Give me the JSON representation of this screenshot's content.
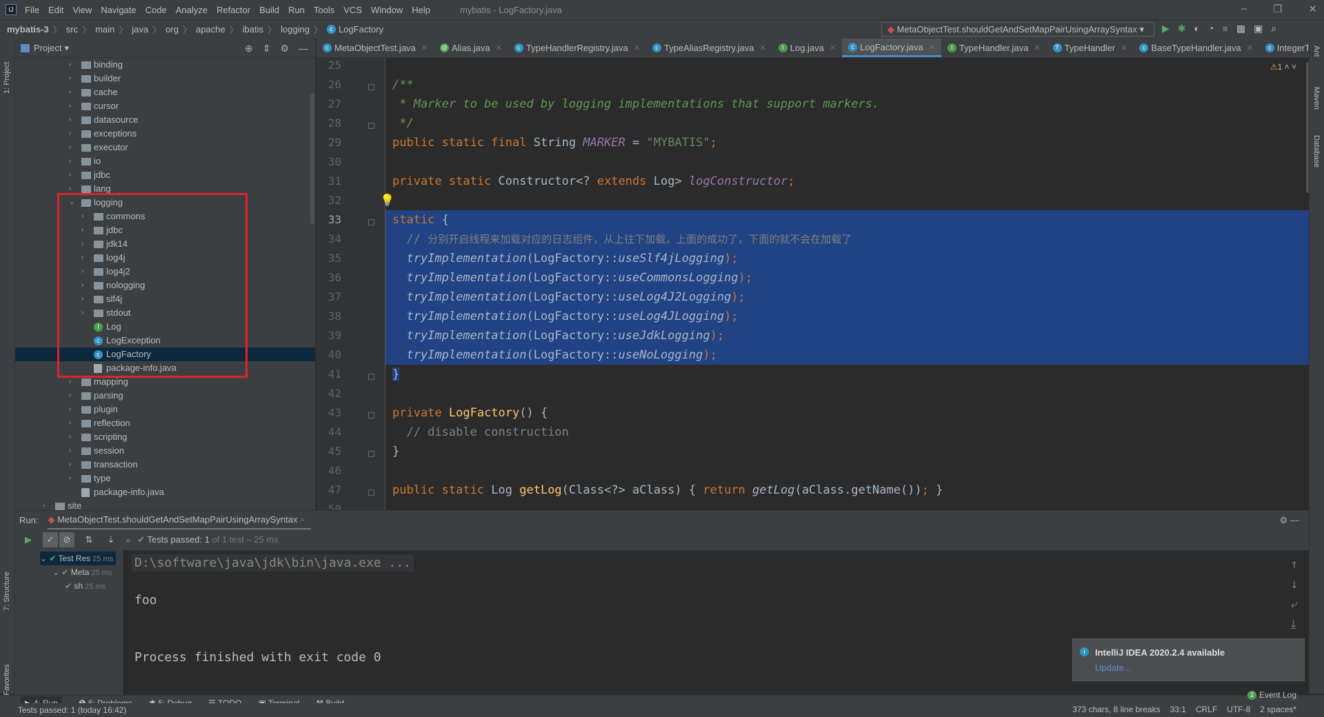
{
  "menu": {
    "items": [
      "File",
      "Edit",
      "View",
      "Navigate",
      "Code",
      "Analyze",
      "Refactor",
      "Build",
      "Run",
      "Tools",
      "VCS",
      "Window",
      "Help"
    ],
    "title": "mybatis - LogFactory.java"
  },
  "breadcrumb": [
    "mybatis-3",
    "src",
    "main",
    "java",
    "org",
    "apache",
    "ibatis",
    "logging",
    "LogFactory"
  ],
  "run_config": "MetaObjectTest.shouldGetAndSetMapPairUsingArraySyntax",
  "left_strip": {
    "project": "1: Project",
    "structure": "7: Structure",
    "favorites": "2: Favorites"
  },
  "right_strip": {
    "ant": "Ant",
    "maven": "Maven",
    "database": "Database"
  },
  "project": {
    "title": "Project",
    "tree": [
      {
        "label": "binding",
        "level": 1,
        "kind": "folder",
        "expanded": false
      },
      {
        "label": "builder",
        "level": 1,
        "kind": "folder",
        "expanded": false
      },
      {
        "label": "cache",
        "level": 1,
        "kind": "folder",
        "expanded": false
      },
      {
        "label": "cursor",
        "level": 1,
        "kind": "folder",
        "expanded": false
      },
      {
        "label": "datasource",
        "level": 1,
        "kind": "folder",
        "expanded": false
      },
      {
        "label": "exceptions",
        "level": 1,
        "kind": "folder",
        "expanded": false
      },
      {
        "label": "executor",
        "level": 1,
        "kind": "folder",
        "expanded": false
      },
      {
        "label": "io",
        "level": 1,
        "kind": "folder",
        "expanded": false
      },
      {
        "label": "jdbc",
        "level": 1,
        "kind": "folder",
        "expanded": false
      },
      {
        "label": "lang",
        "level": 1,
        "kind": "folder",
        "expanded": false
      },
      {
        "label": "logging",
        "level": 1,
        "kind": "folder",
        "expanded": true
      },
      {
        "label": "commons",
        "level": 2,
        "kind": "folder",
        "expanded": false
      },
      {
        "label": "jdbc",
        "level": 2,
        "kind": "folder",
        "expanded": false
      },
      {
        "label": "jdk14",
        "level": 2,
        "kind": "folder",
        "expanded": false
      },
      {
        "label": "log4j",
        "level": 2,
        "kind": "folder",
        "expanded": false
      },
      {
        "label": "log4j2",
        "level": 2,
        "kind": "folder",
        "expanded": false
      },
      {
        "label": "nologging",
        "level": 2,
        "kind": "folder",
        "expanded": false
      },
      {
        "label": "slf4j",
        "level": 2,
        "kind": "folder",
        "expanded": false
      },
      {
        "label": "stdout",
        "level": 2,
        "kind": "folder",
        "expanded": false
      },
      {
        "label": "Log",
        "level": 2,
        "kind": "interface"
      },
      {
        "label": "LogException",
        "level": 2,
        "kind": "class"
      },
      {
        "label": "LogFactory",
        "level": 2,
        "kind": "class",
        "selected": true
      },
      {
        "label": "package-info.java",
        "level": 2,
        "kind": "file"
      },
      {
        "label": "mapping",
        "level": 1,
        "kind": "folder",
        "expanded": false
      },
      {
        "label": "parsing",
        "level": 1,
        "kind": "folder",
        "expanded": false
      },
      {
        "label": "plugin",
        "level": 1,
        "kind": "folder",
        "expanded": false
      },
      {
        "label": "reflection",
        "level": 1,
        "kind": "folder",
        "expanded": false
      },
      {
        "label": "scripting",
        "level": 1,
        "kind": "folder",
        "expanded": false
      },
      {
        "label": "session",
        "level": 1,
        "kind": "folder",
        "expanded": false
      },
      {
        "label": "transaction",
        "level": 1,
        "kind": "folder",
        "expanded": false
      },
      {
        "label": "type",
        "level": 1,
        "kind": "folder",
        "expanded": false
      },
      {
        "label": "package-info.java",
        "level": 1,
        "kind": "file"
      },
      {
        "label": "site",
        "level": -1,
        "kind": "folder",
        "expanded": false
      }
    ]
  },
  "tabs": [
    {
      "label": "MetaObjectTest.java",
      "icon": "c"
    },
    {
      "label": "Alias.java",
      "icon": "@"
    },
    {
      "label": "TypeHandlerRegistry.java",
      "icon": "c"
    },
    {
      "label": "TypeAliasRegistry.java",
      "icon": "c"
    },
    {
      "label": "Log.java",
      "icon": "I"
    },
    {
      "label": "LogFactory.java",
      "icon": "c",
      "active": true
    },
    {
      "label": "TypeHandler.java",
      "icon": "I"
    },
    {
      "label": "TypeHandler",
      "icon": "T"
    },
    {
      "label": "BaseTypeHandler.java",
      "icon": "c"
    },
    {
      "label": "IntegerT",
      "icon": "c"
    }
  ],
  "editor": {
    "warnings": "1",
    "current_line": 33,
    "selection": [
      33,
      41
    ],
    "lines": [
      {
        "n": 25,
        "t": []
      },
      {
        "n": 26,
        "t": [
          [
            "/**",
            "d"
          ]
        ]
      },
      {
        "n": 27,
        "t": [
          [
            " * Marker to be used by logging implementations that support markers.",
            "d"
          ]
        ]
      },
      {
        "n": 28,
        "t": [
          [
            " */",
            "d"
          ]
        ]
      },
      {
        "n": 29,
        "t": [
          [
            "public static final ",
            "k"
          ],
          [
            "String ",
            "p"
          ],
          [
            "MARKER",
            "f"
          ],
          [
            " = ",
            "p"
          ],
          [
            "\"MYBATIS\"",
            "s"
          ],
          [
            ";",
            "k"
          ]
        ]
      },
      {
        "n": 30,
        "t": []
      },
      {
        "n": 31,
        "t": [
          [
            "private static ",
            "k"
          ],
          [
            "Constructor<? ",
            "p"
          ],
          [
            "extends ",
            "k"
          ],
          [
            "Log> ",
            "p"
          ],
          [
            "logConstructor",
            "f"
          ],
          [
            ";",
            "k"
          ]
        ]
      },
      {
        "n": 32,
        "t": []
      },
      {
        "n": 33,
        "t": [
          [
            "static ",
            "k"
          ],
          [
            "{",
            "p"
          ]
        ]
      },
      {
        "n": 34,
        "t": [
          [
            "  // ",
            "c"
          ],
          [
            "分别开启线程来加载对应的日志组件，从上往下加载，上面的成功了，下面的就不会在加载了",
            "cn"
          ]
        ]
      },
      {
        "n": 35,
        "t": [
          [
            "  tryImplementation",
            "m"
          ],
          [
            "(LogFactory::",
            "p"
          ],
          [
            "useSlf4jLogging",
            "m"
          ],
          [
            ");",
            "k"
          ]
        ]
      },
      {
        "n": 36,
        "t": [
          [
            "  tryImplementation",
            "m"
          ],
          [
            "(LogFactory::",
            "p"
          ],
          [
            "useCommonsLogging",
            "m"
          ],
          [
            ");",
            "k"
          ]
        ]
      },
      {
        "n": 37,
        "t": [
          [
            "  tryImplementation",
            "m"
          ],
          [
            "(LogFactory::",
            "p"
          ],
          [
            "useLog4J2Logging",
            "m"
          ],
          [
            ");",
            "k"
          ]
        ]
      },
      {
        "n": 38,
        "t": [
          [
            "  tryImplementation",
            "m"
          ],
          [
            "(LogFactory::",
            "p"
          ],
          [
            "useLog4JLogging",
            "m"
          ],
          [
            ");",
            "k"
          ]
        ]
      },
      {
        "n": 39,
        "t": [
          [
            "  tryImplementation",
            "m"
          ],
          [
            "(LogFactory::",
            "p"
          ],
          [
            "useJdkLogging",
            "m"
          ],
          [
            ");",
            "k"
          ]
        ]
      },
      {
        "n": 40,
        "t": [
          [
            "  tryImplementation",
            "m"
          ],
          [
            "(LogFactory::",
            "p"
          ],
          [
            "useNoLogging",
            "m"
          ],
          [
            ");",
            "k"
          ]
        ]
      },
      {
        "n": 41,
        "t": [
          [
            "}",
            "p"
          ]
        ]
      },
      {
        "n": 42,
        "t": []
      },
      {
        "n": 43,
        "t": [
          [
            "private ",
            "k"
          ],
          [
            "LogFactory",
            "md"
          ],
          [
            "() {",
            "p"
          ]
        ]
      },
      {
        "n": 44,
        "t": [
          [
            "  // disable construction",
            "c"
          ]
        ]
      },
      {
        "n": 45,
        "t": [
          [
            "}",
            "p"
          ]
        ]
      },
      {
        "n": 46,
        "t": []
      },
      {
        "n": 47,
        "t": [
          [
            "public static ",
            "k"
          ],
          [
            "Log ",
            "p"
          ],
          [
            "getLog",
            "md"
          ],
          [
            "(Class<?> aClass) { ",
            "p"
          ],
          [
            "return ",
            "k"
          ],
          [
            "getLog",
            "m"
          ],
          [
            "(aClass.getName())",
            "p"
          ],
          [
            "; ",
            "k"
          ],
          [
            "}",
            "p"
          ]
        ]
      },
      {
        "n": 50,
        "t": []
      }
    ]
  },
  "run": {
    "label": "Run:",
    "tab": "MetaObjectTest.shouldGetAndSetMapPairUsingArraySyntax",
    "status": "Tests passed:",
    "status_count": "1",
    "status_detail": "of 1 test – 25 ms",
    "tree": [
      {
        "label": "Test Res",
        "time": "25 ms"
      },
      {
        "label": "Meta",
        "time": "25 ms"
      },
      {
        "label": "sh",
        "time": "25 ms"
      }
    ],
    "console": [
      "D:\\software\\java\\jdk\\bin\\java.exe ...",
      "foo",
      "Process finished with exit code 0"
    ]
  },
  "notification": {
    "title": "IntelliJ IDEA 2020.2.4 available",
    "link": "Update..."
  },
  "bottom_tabs": [
    "4: Run",
    "6: Problems",
    "5: Debug",
    "TODO",
    "Terminal",
    "Build"
  ],
  "event_log": {
    "count": "2",
    "label": "Event Log"
  },
  "status": {
    "left": "Tests passed: 1 (today 16:42)",
    "chars": "373 chars, 8 line breaks",
    "pos": "33:1",
    "eol": "CRLF",
    "enc": "UTF-8",
    "indent": "2 spaces*"
  },
  "colors": {
    "selection": "#214283",
    "keyword": "#cc7832",
    "string": "#6a8759",
    "accent": "#4a88c7",
    "highlight_box": "#e0232b",
    "pass": "#5ca85c"
  }
}
